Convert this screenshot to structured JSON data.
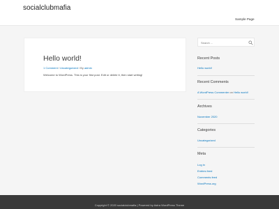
{
  "header": {
    "site_title": "socialclubmafia",
    "nav": {
      "sample_page": "Sample Page"
    }
  },
  "post": {
    "title": "Hello world!",
    "meta": {
      "comments": "1 Comment",
      "sep1": " / ",
      "category": "Uncategorized",
      "sep2": " / By ",
      "author": "admin"
    },
    "excerpt": "Welcome to WordPress. This is your first post. Edit or delete it, then start writing!"
  },
  "sidebar": {
    "search": {
      "placeholder": "Search ..."
    },
    "recent_posts": {
      "title": "Recent Posts",
      "items": [
        "Hello world!"
      ]
    },
    "recent_comments": {
      "title": "Recent Comments",
      "author": "A WordPress Commenter",
      "on": " on ",
      "post": "Hello world!"
    },
    "archives": {
      "title": "Archives",
      "items": [
        "November 2020"
      ]
    },
    "categories": {
      "title": "Categories",
      "items": [
        "Uncategorized"
      ]
    },
    "meta": {
      "title": "Meta",
      "items": [
        "Log in",
        "Entries feed",
        "Comments feed",
        "WordPress.org"
      ]
    }
  },
  "footer": {
    "text": "Copyright © 2020 socialclubmafia | Powered by Astra WordPress Theme"
  },
  "colors": {
    "link": "#0274be",
    "background": "#f5f5f5",
    "footer_bg": "#3a3a3a"
  }
}
